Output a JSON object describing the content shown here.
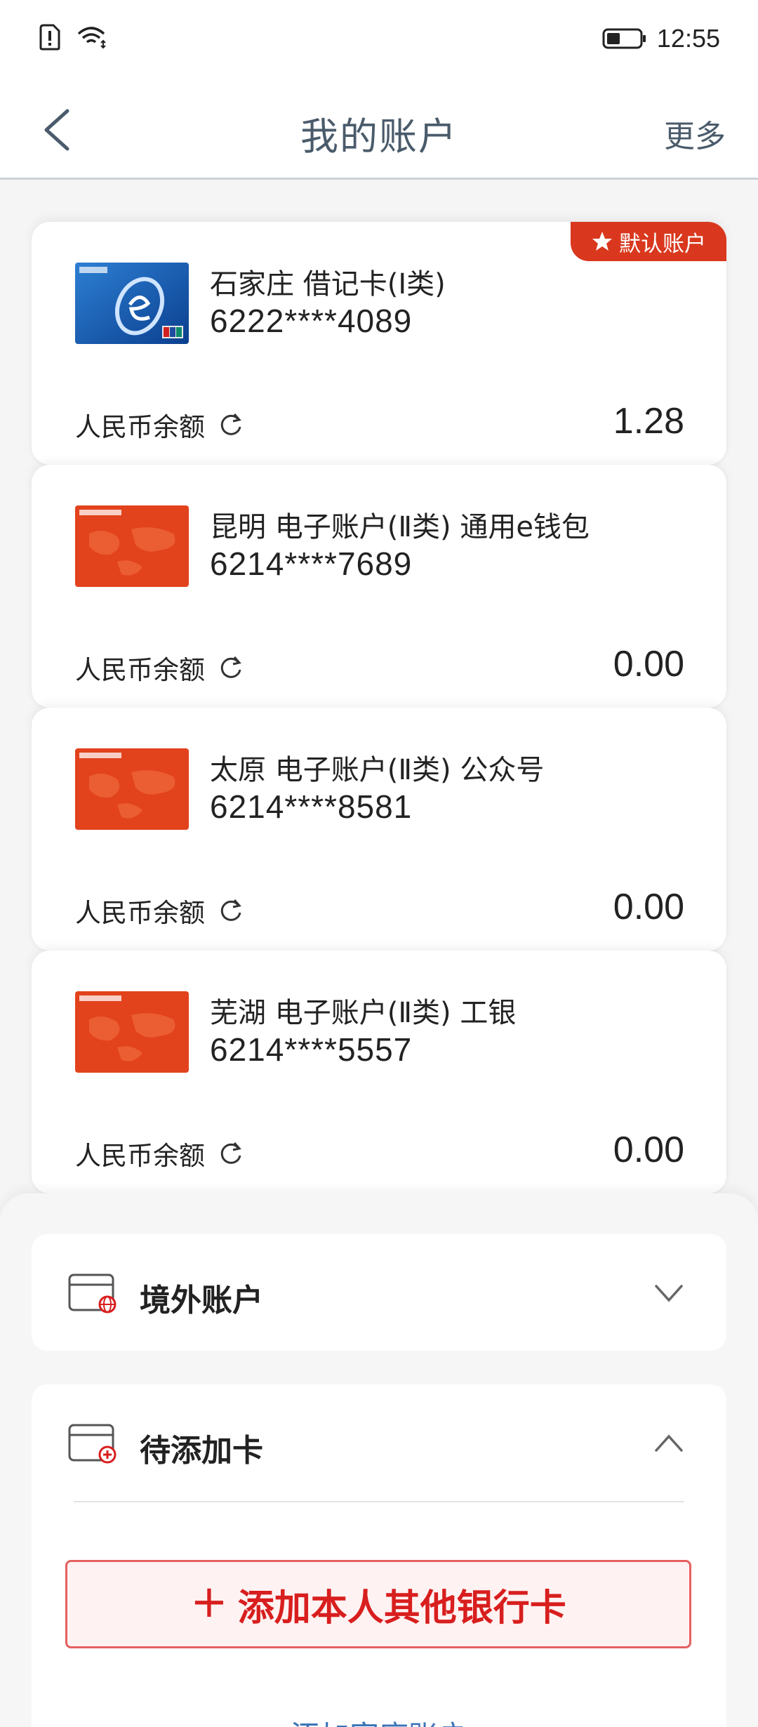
{
  "status_bar": {
    "time": "12:55"
  },
  "header": {
    "title": "我的账户",
    "more_label": "更多"
  },
  "accounts": [
    {
      "name": "石家庄 借记卡(Ⅰ类)",
      "number": "6222****4089",
      "balance_label": "人民币余额",
      "balance": "1.28",
      "default_badge": "默认账户",
      "card_style": "blue-e"
    },
    {
      "name": "昆明 电子账户(Ⅱ类) 通用e钱包",
      "number": "6214****7689",
      "balance_label": "人民币余额",
      "balance": "0.00",
      "card_style": "red-map"
    },
    {
      "name": "太原 电子账户(Ⅱ类) 公众号",
      "number": "6214****8581",
      "balance_label": "人民币余额",
      "balance": "0.00",
      "card_style": "red-map"
    },
    {
      "name": "芜湖 电子账户(Ⅱ类) 工银",
      "number": "6214****5557",
      "balance_label": "人民币余额",
      "balance": "0.00",
      "card_style": "red-map"
    }
  ],
  "sections": {
    "abroad": {
      "title": "境外账户",
      "icon": "card-globe-icon",
      "state": "collapsed"
    },
    "pending": {
      "title": "待添加卡",
      "icon": "card-add-icon",
      "state": "expanded"
    }
  },
  "add_card_button": {
    "plus": "+",
    "label": "添加本人其他银行卡"
  },
  "family_link": {
    "label": "添加家庭账户"
  },
  "colors": {
    "accent_red": "#d81e1e",
    "badge_red": "#d9381e",
    "link_blue": "#3a73b8",
    "title_gray": "#4a5b6b"
  }
}
